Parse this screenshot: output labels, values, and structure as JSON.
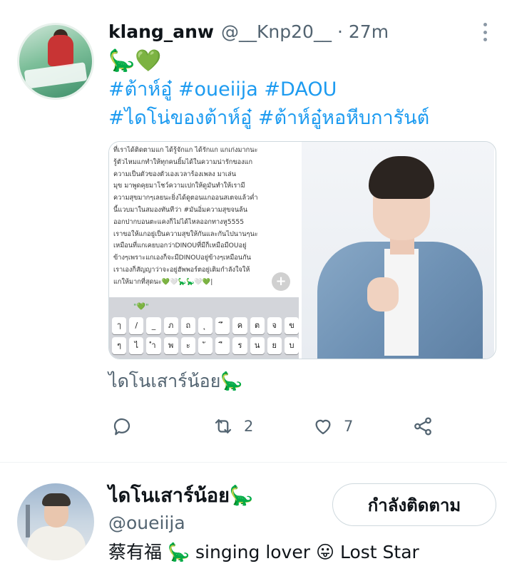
{
  "tweet": {
    "display_name": "klang_anw",
    "handle": "@__Knp20__",
    "separator": "·",
    "time": "27m",
    "emojis": "🦕💚",
    "hashtags_line1": "#ต้าห์อู๋ #oueiija #DAOU",
    "hashtags_line2": "#ไดโน่ของต้าห์อู๋ #ต้าห์อู๋หอหีบการันต์",
    "caption": "ไดโนเสาร์น้อย🦕",
    "screenshot_text": [
      "ที่เราได้ติดตามแก ได้รู้จักแก ได้รักแก แกเก่งมากนะ",
      "รู้ตัวไหมแกทำให้ทุกคนยิ้มได้ในความน่ารักของแก",
      "ความเป็นตัวของตัวเองเวลาร้องเพลง มาเล่น",
      "มุข มาพูดคุยมาโชว์ความเปกให้ดูมันทำให้เรามี",
      "ความสุขมากๆเลยนะยิ่งได้ดูตอนแกออนสเตจแล้วค่ำ",
      "นี้แวบมาในสมองทันทีว่า #มันอิ่มความสุขจนล้น",
      "ออกปากบอนตะแคงก็ไม่ได้ไหลออกทางหู5555",
      "เราขอให้แกอยู่เป็นความสุขให้กันและกันไปนานๆนะ",
      "เหมือนที่แกเคยบอกว่าDINOUที่มีก็เหมือมีOUอยู่",
      "ข้างๆเพราะแกเองก็จะมีDINOUอยู่ข้างๆเหมือนกัน",
      "เราเองก็สัญญาว่าจะอยู่ฮัพพอร์ตอยู่เติมกำลังใจให้",
      "แกให้มากที่สุดนะ💚🤍🦕🦕🤍💚|"
    ],
    "keyboard": {
      "suggestion": "\"💚\"",
      "row1": [
        "ๅ",
        "/",
        "_",
        "ภ",
        "ถ",
        "ุ",
        "ึ",
        "ค",
        "ต",
        "จ",
        "ข"
      ],
      "row2": [
        "ๆ",
        "ไ",
        "ำ",
        "พ",
        "ะ",
        "ั",
        "ี",
        "ร",
        "น",
        "ย",
        "บ"
      ]
    },
    "plus_label": "+",
    "actions": {
      "reply_count": "",
      "retweet_count": "2",
      "like_count": "7"
    }
  },
  "profile": {
    "display_name": "ไดโนเสาร์น้อย🦕",
    "handle": "@oueiija",
    "bio": "蔡有福 🦕 singing lover 😛 Lost Star",
    "follow_button": "กำลังติดตาม"
  },
  "icons": {
    "more": "more-icon",
    "reply": "reply-icon",
    "retweet": "retweet-icon",
    "like": "heart-icon",
    "share": "share-icon"
  },
  "colors": {
    "link": "#1d9bf0",
    "secondary_text": "#536471",
    "primary_text": "#0f1419",
    "border": "#cfd9de"
  }
}
